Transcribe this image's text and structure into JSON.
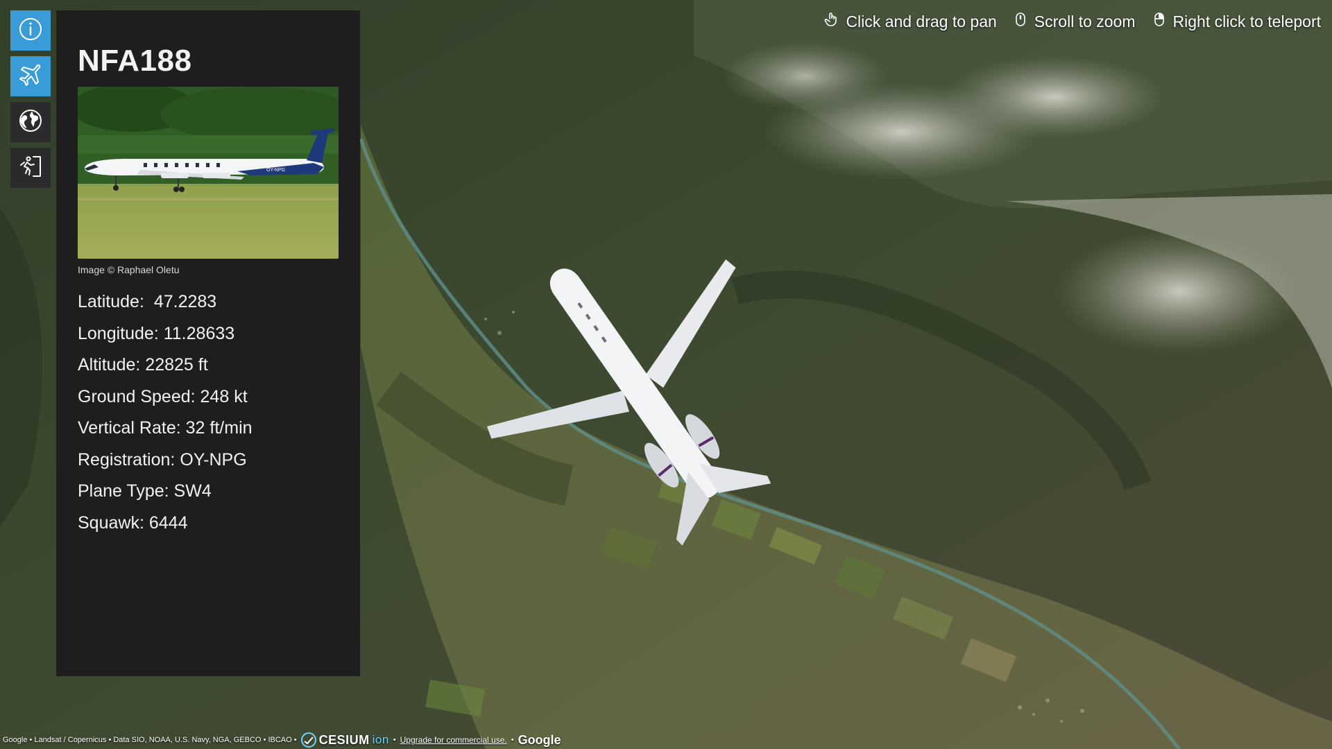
{
  "hints": [
    {
      "icon": "hand-pointer-icon",
      "text": "Click and drag to pan"
    },
    {
      "icon": "mouse-scroll-icon",
      "text": "Scroll to zoom"
    },
    {
      "icon": "mouse-right-click-icon",
      "text": "Right click to teleport"
    }
  ],
  "toolbar": [
    {
      "icon": "info-icon",
      "active": true
    },
    {
      "icon": "plane-icon",
      "active": true
    },
    {
      "icon": "globe-icon",
      "active": false
    },
    {
      "icon": "exit-icon",
      "active": false
    }
  ],
  "panel": {
    "callsign": "NFA188",
    "photo_registration": "OY-NPG",
    "credit": "Image © Raphael Oletu",
    "fields": [
      {
        "label": "Latitude",
        "value": " 47.2283"
      },
      {
        "label": "Longitude",
        "value": "11.28633"
      },
      {
        "label": "Altitude",
        "value": "22825 ft"
      },
      {
        "label": "Ground Speed",
        "value": "248 kt"
      },
      {
        "label": "Vertical Rate",
        "value": "32 ft/min"
      },
      {
        "label": "Registration",
        "value": "OY-NPG"
      },
      {
        "label": "Plane Type",
        "value": "SW4"
      },
      {
        "label": "Squawk",
        "value": "6444"
      }
    ]
  },
  "attribution": {
    "sources": "Google • Landsat / Copernicus • Data SIO, NOAA, U.S. Navy, NGA, GEBCO • IBCAO •",
    "cesium": "CESIUM",
    "cesium_ion": "ion",
    "upgrade_link": "Upgrade for commercial use.",
    "separator": "•",
    "google": "Google"
  },
  "colors": {
    "accent": "#3a9bd9",
    "panel_bg": "#1e1e1e",
    "toolbar_bg": "#2b2b2b"
  }
}
